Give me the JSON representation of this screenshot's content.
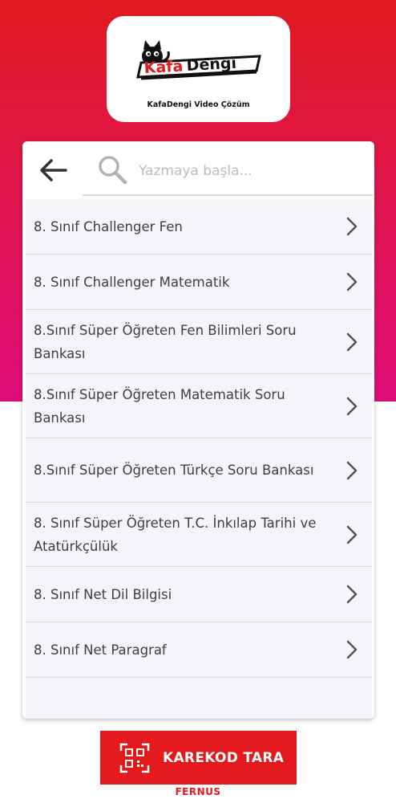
{
  "logo": {
    "wordmark_part1": "Kafa",
    "wordmark_part2": "Dengi",
    "caption": "KafaDengi Video Çözüm"
  },
  "search": {
    "placeholder": "Yazmaya başla...",
    "value": ""
  },
  "items": [
    {
      "label": "8. Sınıf Challenger Fen"
    },
    {
      "label": "8. Sınıf Challenger Matematik"
    },
    {
      "label": "8.Sınıf Süper Öğreten Fen Bilimleri Soru Bankası"
    },
    {
      "label": "8.Sınıf Süper Öğreten Matematik Soru Bankası"
    },
    {
      "label": "8.Sınıf Süper Öğreten Türkçe Soru Bankası"
    },
    {
      "label": "8. Sınıf Süper Öğreten T.C. İnkılap Tarihi ve Atatürkçülük"
    },
    {
      "label": "8. Sınıf Net Dil Bilgisi"
    },
    {
      "label": "8. Sınıf Net Paragraf"
    }
  ],
  "qr_button": {
    "label": "KAREKOD TARA"
  },
  "footer": {
    "brand": "FERNUS"
  },
  "colors": {
    "accent": "#e3191d",
    "gradient_bottom": "#dd0d78"
  },
  "icons": {
    "back": "arrow-left-icon",
    "search": "search-icon",
    "chevron": "chevron-right-icon",
    "qr": "qr-scan-icon"
  }
}
